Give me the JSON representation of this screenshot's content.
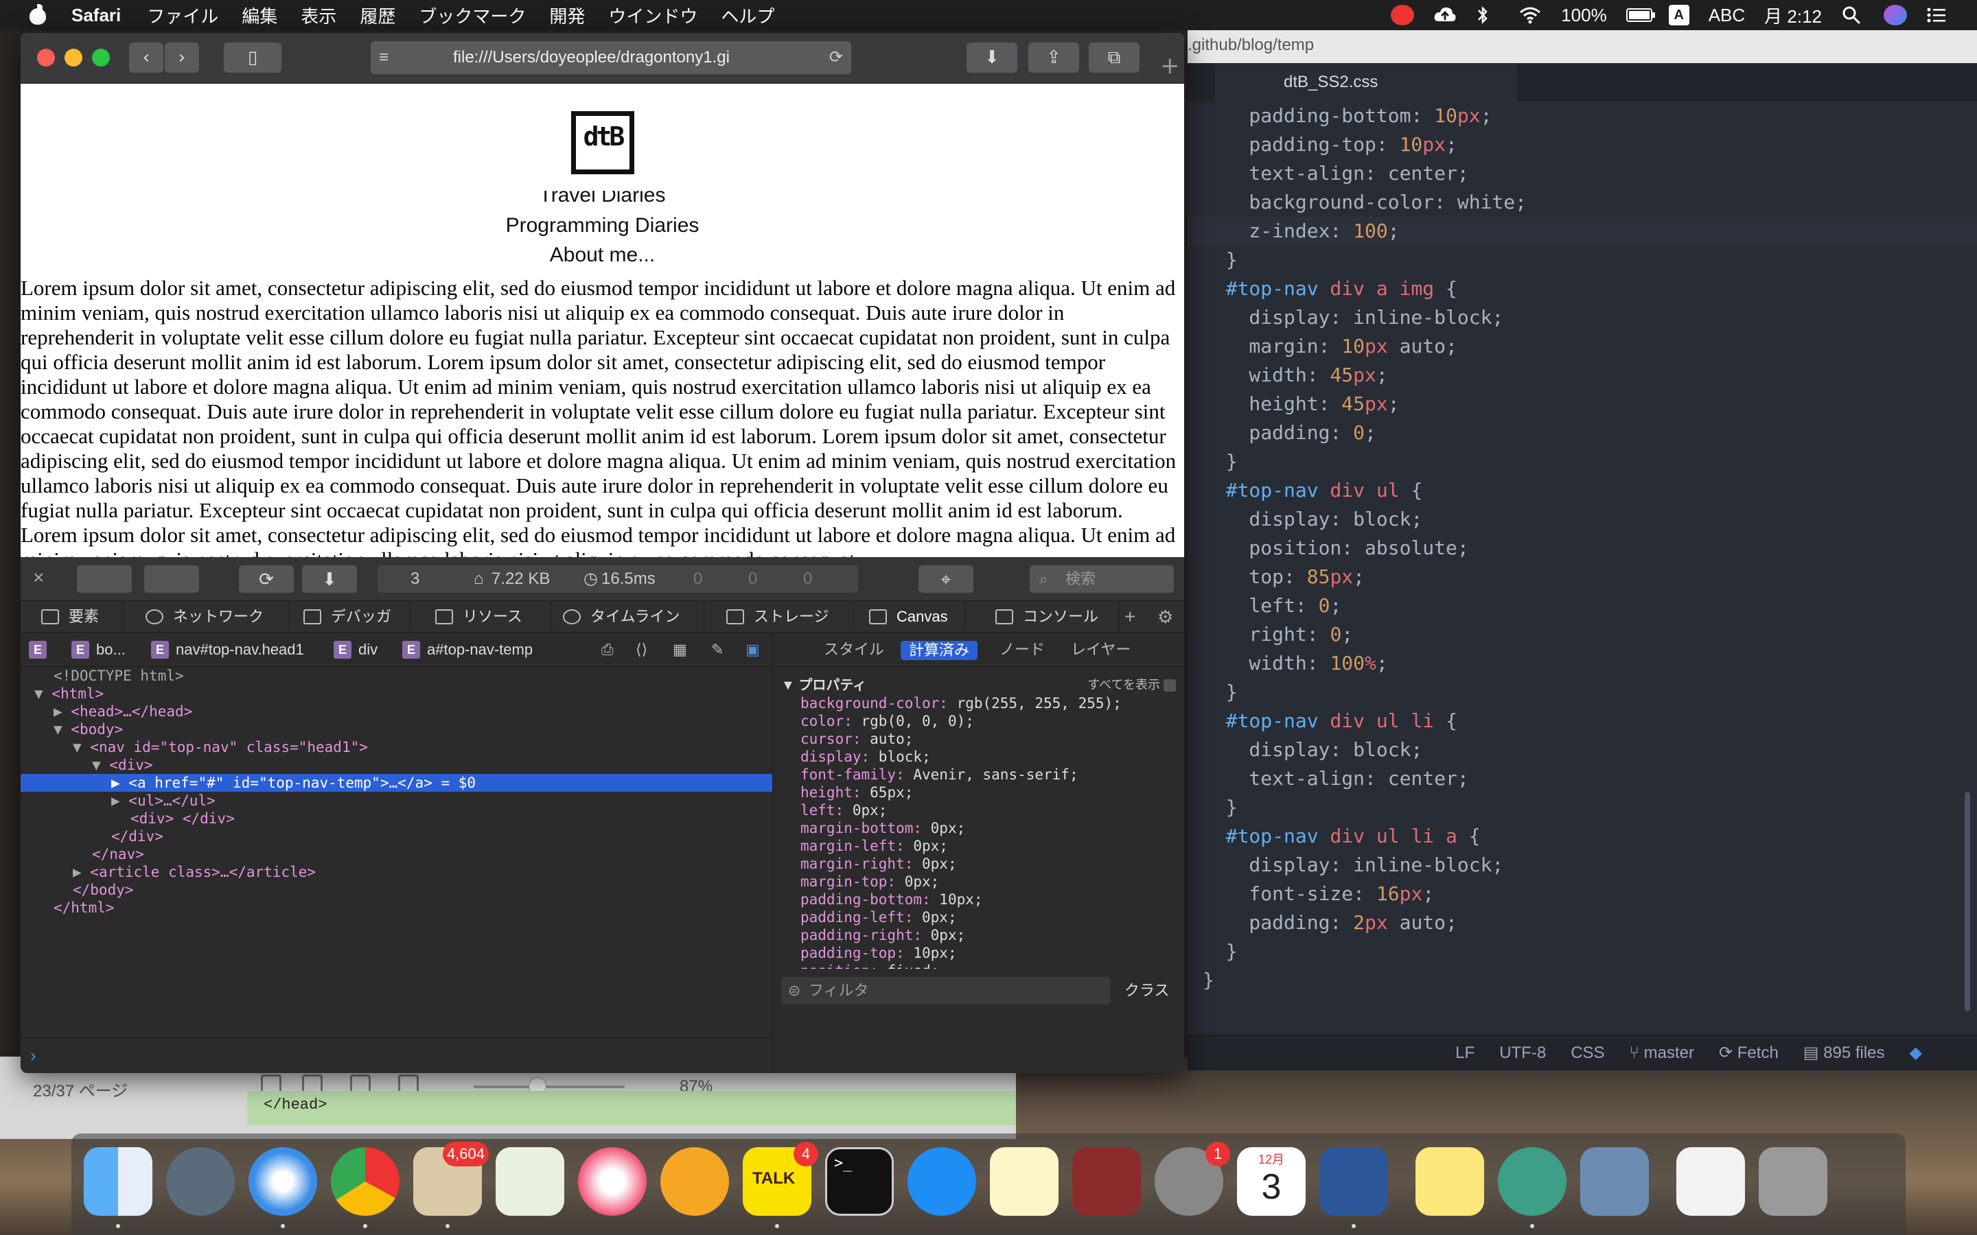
{
  "menubar": {
    "app": "Safari",
    "items": [
      "ファイル",
      "編集",
      "表示",
      "履歴",
      "ブックマーク",
      "開発",
      "ウインドウ",
      "ヘルプ"
    ],
    "battery": "100%",
    "input_mode": "ABC",
    "input_icon": "A",
    "clock": "月 2:12"
  },
  "safari": {
    "url": "file:///Users/doyeoplee/dragontony1.gi",
    "page": {
      "logo_text": "dtB",
      "nav_links": [
        "Travel Diaries",
        "Programming Diaries",
        "About me..."
      ],
      "body_text": "Lorem ipsum dolor sit amet, consectetur adipiscing elit, sed do eiusmod tempor incididunt ut labore et dolore magna aliqua. Ut enim ad minim veniam, quis nostrud exercitation ullamco laboris nisi ut aliquip ex ea commodo consequat. Duis aute irure dolor in reprehenderit in voluptate velit esse cillum dolore eu fugiat nulla pariatur. Excepteur sint occaecat cupidatat non proident, sunt in culpa qui officia deserunt mollit anim id est laborum. Lorem ipsum dolor sit amet, consectetur adipiscing elit, sed do eiusmod tempor incididunt ut labore et dolore magna aliqua. Ut enim ad minim veniam, quis nostrud exercitation ullamco laboris nisi ut aliquip ex ea commodo consequat. Duis aute irure dolor in reprehenderit in voluptate velit esse cillum dolore eu fugiat nulla pariatur. Excepteur sint occaecat cupidatat non proident, sunt in culpa qui officia deserunt mollit anim id est laborum. Lorem ipsum dolor sit amet, consectetur adipiscing elit, sed do eiusmod tempor incididunt ut labore et dolore magna aliqua. Ut enim ad minim veniam, quis nostrud exercitation ullamco laboris nisi ut aliquip ex ea commodo consequat. Duis aute irure dolor in reprehenderit in voluptate velit esse cillum dolore eu fugiat nulla pariatur. Excepteur sint occaecat cupidatat non proident, sunt in culpa qui officia deserunt mollit anim id est laborum. Lorem ipsum dolor sit amet, consectetur adipiscing elit, sed do eiusmod tempor incididunt ut labore et dolore magna aliqua. Ut enim ad minim veniam, quis nostrud exercitation ullamco laboris nisi ut aliquip ex ea commodo consequat."
    }
  },
  "inspector": {
    "stats": {
      "resources": "3",
      "size": "7.22 KB",
      "time": "16.5ms",
      "messages": "0",
      "errors": "0",
      "warnings": "0"
    },
    "search_placeholder": "検索",
    "tabs": [
      "要素",
      "ネットワーク",
      "デバッガ",
      "リソース",
      "タイムライン",
      "ストレージ",
      "Canvas",
      "コンソール"
    ],
    "breadcrumbs": [
      "bo...",
      "nav#top-nav.head1",
      "div",
      "a#top-nav-temp"
    ],
    "dom_lines": [
      "<!DOCTYPE html>",
      "<html>",
      "<head>…</head>",
      "<body>",
      "<nav id=\"top-nav\" class=\"head1\">",
      "<div>",
      "<a href=\"#\" id=\"top-nav-temp\">…</a> = $0",
      "<ul>…</ul>",
      "<div> </div>",
      "</div>",
      "</nav>",
      "<article class>…</article>",
      "</body>",
      "</html>"
    ],
    "side_tabs": [
      "スタイル",
      "計算済み",
      "ノード",
      "レイヤー"
    ],
    "active_side_tab": "計算済み",
    "props_heading": "プロパティ",
    "show_all": "すべてを表示",
    "properties": [
      [
        "background-color",
        "rgb(255, 255, 255);"
      ],
      [
        "color",
        "rgb(0, 0, 0);"
      ],
      [
        "cursor",
        "auto;"
      ],
      [
        "display",
        "block;"
      ],
      [
        "font-family",
        "Avenir, sans-serif;"
      ],
      [
        "height",
        "65px;"
      ],
      [
        "left",
        "0px;"
      ],
      [
        "margin-bottom",
        "0px;"
      ],
      [
        "margin-left",
        "0px;"
      ],
      [
        "margin-right",
        "0px;"
      ],
      [
        "margin-top",
        "0px;"
      ],
      [
        "padding-bottom",
        "10px;"
      ],
      [
        "padding-left",
        "0px;"
      ],
      [
        "padding-right",
        "0px;"
      ],
      [
        "padding-top",
        "10px;"
      ],
      [
        "position",
        "fixed;"
      ]
    ],
    "filter_placeholder": "フィルタ",
    "class_button": "クラス"
  },
  "editor": {
    "path": ".github/blog/temp",
    "tab": "dtB_SS2.css",
    "code": [
      "    padding-bottom: 10px;",
      "    padding-top: 10px;",
      "    text-align: center;",
      "    background-color: white;",
      "    z-index: 100;",
      "  }",
      "  #top-nav div a img {",
      "    display: inline-block;",
      "    margin: 10px auto;",
      "    width: 45px;",
      "    height: 45px;",
      "    padding: 0;",
      "  }",
      "  #top-nav div ul {",
      "    display: block;",
      "    position: absolute;",
      "    top: 85px;",
      "    left: 0;",
      "    right: 0;",
      "    width: 100%;",
      "  }",
      "  #top-nav div ul li {",
      "    display: block;",
      "    text-align: center;",
      "  }",
      "  #top-nav div ul li a {",
      "    display: inline-block;",
      "    font-size: 16px;",
      "    padding: 2px auto;",
      "  }",
      "}"
    ],
    "status": {
      "eol": "LF",
      "encoding": "UTF-8",
      "grammar": "CSS",
      "branch": "master",
      "fetch": "Fetch",
      "files": "895 files"
    }
  },
  "background_window": {
    "page_label": "23/37 ページ",
    "zoom": "87%",
    "code_snippet": "</head>"
  },
  "dock": {
    "badges": {
      "mail": "4,604",
      "kakaotalk": "4",
      "system_prefs": "1"
    },
    "calendar": {
      "month": "12月",
      "day": "3"
    },
    "kakaotalk_label": "TALK"
  }
}
